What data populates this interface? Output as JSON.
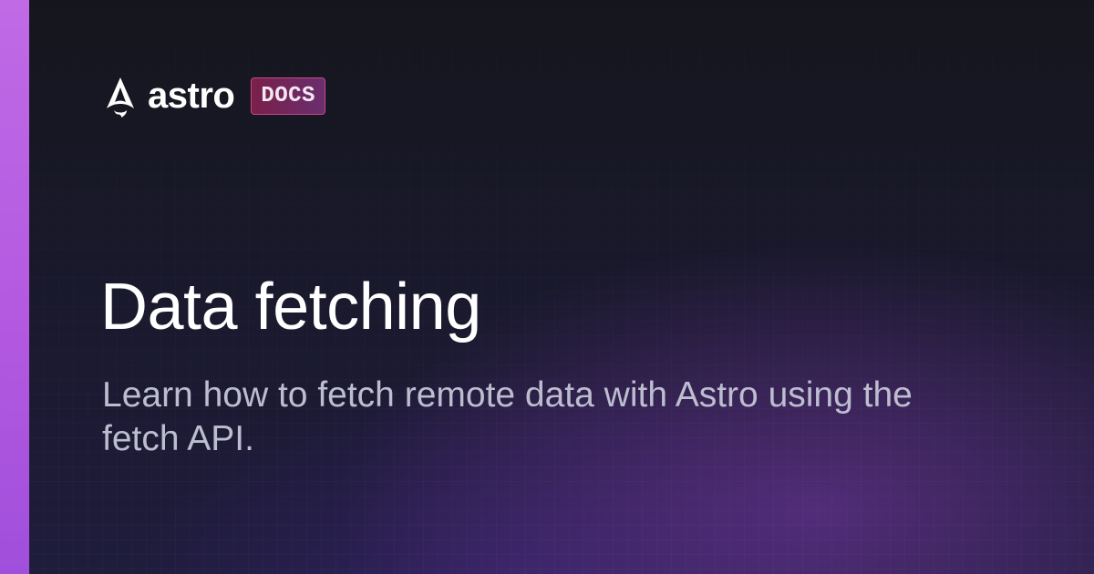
{
  "brand": {
    "logo_icon": "astro-rocket-icon",
    "wordmark": "astro",
    "badge": "DOCS"
  },
  "page": {
    "title": "Data fetching",
    "description": "Learn how to fetch remote data with Astro using the fetch API."
  },
  "colors": {
    "accent_bar": "#b65ae2",
    "badge_border": "#c24b87",
    "badge_fill": "#7a1f4a",
    "title_text": "#ffffff",
    "description_text": "#bdbdd0",
    "background": "#161722"
  }
}
